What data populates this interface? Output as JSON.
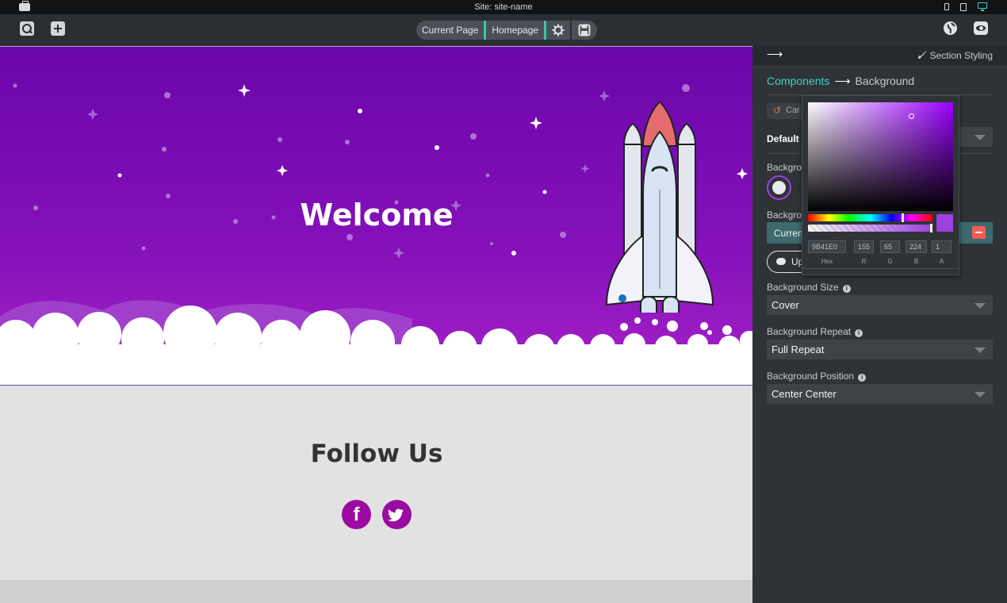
{
  "window": {
    "title": "Site: site-name"
  },
  "toolbar": {
    "current_page_label": "Current Page",
    "homepage_label": "Homepage"
  },
  "hero": {
    "title": "Welcome"
  },
  "follow": {
    "title": "Follow Us",
    "facebook_glyph": "f"
  },
  "panel": {
    "section_styling": "Section Styling",
    "breadcrumb": {
      "root": "Components",
      "current": "Background"
    },
    "cancel_label": "Car",
    "default_label": "Default",
    "background_color_label": "Backgro",
    "background_image_label": "Backgro",
    "current_image_label": "Curren",
    "upload_label": "Up",
    "size": {
      "label": "Background Size",
      "value": "Cover"
    },
    "repeat": {
      "label": "Background Repeat",
      "value": "Full Repeat"
    },
    "position": {
      "label": "Background Position",
      "value": "Center Center"
    }
  },
  "picker": {
    "color": "#9B41E0",
    "hex": "9B41E0",
    "r": "155",
    "g": "65",
    "b": "224",
    "a": "1",
    "labels": {
      "hex": "Hex",
      "r": "R",
      "g": "G",
      "b": "B",
      "a": "A"
    }
  },
  "colors": {
    "accent": "#3fd2c2",
    "hero_purple": "#7a0cb4",
    "social_purple": "#9b0aa1",
    "remove_red": "#f25b57"
  },
  "icons": [
    "briefcase-icon",
    "phone-icon",
    "tablet-icon",
    "desktop-icon",
    "search-icon",
    "add-icon",
    "gear-icon",
    "save-icon",
    "globe-icon",
    "eye-icon",
    "arrow-right-icon",
    "paintbrush-icon",
    "undo-icon",
    "palette-icon",
    "minus-icon",
    "cloud-upload-icon",
    "info-icon",
    "chevron-down-icon",
    "facebook-icon",
    "twitter-icon",
    "rocket-illustration"
  ]
}
